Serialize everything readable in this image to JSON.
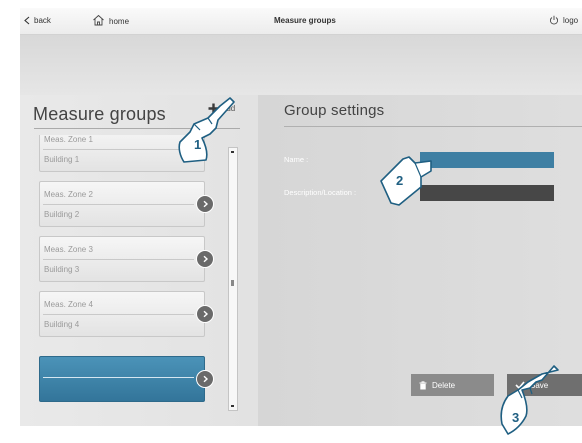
{
  "topbar": {
    "back_label": "back",
    "home_label": "home",
    "title": "Measure groups",
    "logout_label": "logo"
  },
  "left": {
    "title": "Measure groups",
    "add_label": "Add",
    "items": [
      {
        "zone": "Meas. Zone 1",
        "building": "Building 1"
      },
      {
        "zone": "Meas. Zone 2",
        "building": "Building 2"
      },
      {
        "zone": "Meas. Zone 3",
        "building": "Building 3"
      },
      {
        "zone": "Meas. Zone 4",
        "building": "Building 4"
      }
    ]
  },
  "right": {
    "title": "Group settings",
    "name_label": "Name :",
    "name_value": "",
    "description_label": "Description/Location :",
    "description_value": "",
    "delete_label": "Delete",
    "save_label": "Save"
  },
  "callouts": [
    "1",
    "2",
    "3"
  ],
  "colors": {
    "selected_blue": "#3d82a6",
    "name_field_blue": "#3e7fa3",
    "description_field_dark": "#474747",
    "delete_button": "#8a8a8a",
    "save_button": "#6f6f6f",
    "callout_fill": "#ffffff",
    "callout_text": "#1f5f82"
  },
  "icons": {
    "back": "chevron-left-icon",
    "home": "home-icon",
    "logout": "power-icon",
    "add": "plus-icon",
    "row_arrow": "chevron-right-circle-icon",
    "delete": "trash-icon",
    "save": "checkmark-icon",
    "pointer": "pointing-hand-icon"
  }
}
